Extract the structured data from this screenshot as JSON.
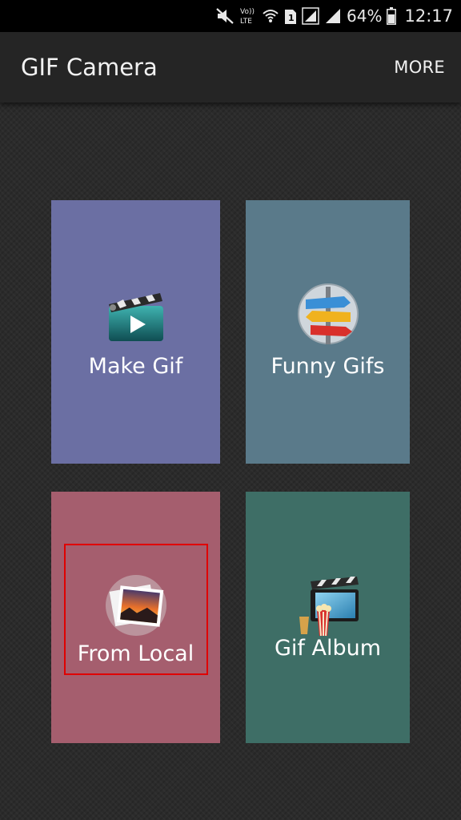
{
  "status_bar": {
    "icons": [
      "mute-icon",
      "volte-icon",
      "wifi-icon",
      "sim1-icon",
      "signal-icon",
      "signal-icon",
      "battery-icon"
    ],
    "volte_text": "Vo)) LTE",
    "battery_percent": "64%",
    "time": "12:17"
  },
  "app_bar": {
    "title": "GIF Camera",
    "more_label": "MORE"
  },
  "tiles": [
    {
      "label": "Make Gif",
      "icon": "clapperboard-play-icon",
      "color": "#6b6fa3"
    },
    {
      "label": "Funny Gifs",
      "icon": "signpost-icon",
      "color": "#5a7a8a"
    },
    {
      "label": "From Local",
      "icon": "photos-icon",
      "color": "#a55e6e"
    },
    {
      "label": "Gif Album",
      "icon": "clapperboard-popcorn-icon",
      "color": "#3e6e66"
    }
  ],
  "highlight_color": "#e00000"
}
